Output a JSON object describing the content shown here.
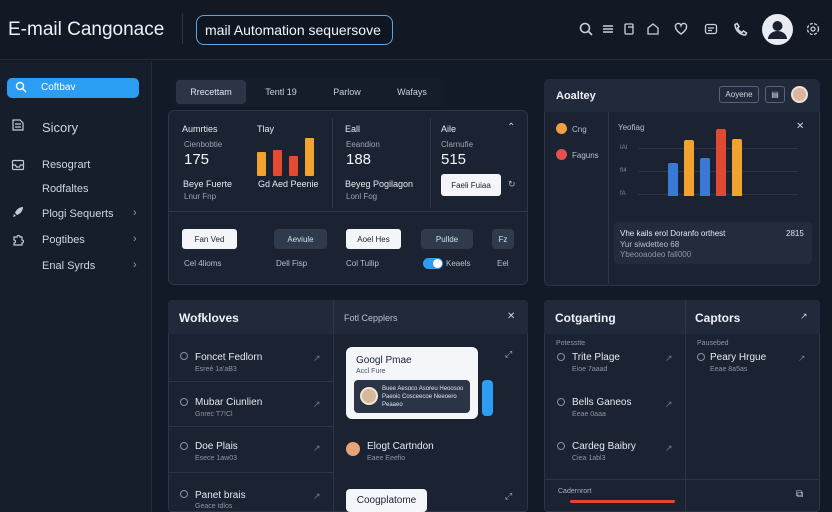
{
  "app": {
    "title": "E-mail Cangonace",
    "search_value": "mail Automation sequersove"
  },
  "header_icons": [
    "search-icon",
    "list-icon",
    "copy-icon",
    "tag-icon",
    "heart-icon",
    "message-icon",
    "phone-icon",
    "user-avatar",
    "settings-icon"
  ],
  "sidebar": {
    "items": [
      {
        "label": "Coftbav",
        "icon": "search-icon"
      },
      {
        "label": "Sicory",
        "icon": "book-icon"
      },
      {
        "label": "Resogrart",
        "icon": "inbox-icon"
      },
      {
        "label": "Rodfaltes",
        "icon": ""
      },
      {
        "label": "Plogi Sequerts",
        "icon": "rocket-icon"
      },
      {
        "label": "Pogtibes",
        "icon": "puzzle-icon"
      },
      {
        "label": "Enal Syrds",
        "icon": ""
      }
    ]
  },
  "tabs": [
    "Rrecettam",
    "Tentl 19",
    "Parlow",
    "Wafays"
  ],
  "cards": [
    {
      "title": "Aumrties",
      "sub": "Cienbobtie",
      "value": "175",
      "label": "Beye Fuerte",
      "note": "Lnur Fnp"
    },
    {
      "title": "Tlay",
      "sub": "",
      "value": "",
      "label": "Gd Aed Peenie",
      "note": ""
    },
    {
      "title": "Eall",
      "sub": "Eeandion",
      "value": "188",
      "label": "Beyeg Pogilagon",
      "note": "Lonl Fog"
    },
    {
      "title": "Aile",
      "sub": "Clarnufie",
      "value": "515",
      "label": "",
      "note": ""
    }
  ],
  "card_buttons": {
    "new": "Faeli Fuiaa",
    "refresh": "↻"
  },
  "actions": [
    {
      "label": "Fan Ved",
      "note": "Cel 4lioms",
      "style": "light"
    },
    {
      "label": "Aeviule",
      "note": "Dell Fisp",
      "style": "dark"
    },
    {
      "label": "Aoel Hes",
      "note": "Col Tullip",
      "style": "light"
    },
    {
      "label": "Pullde",
      "note": "Keaels",
      "style": "dark"
    },
    {
      "label": "Fz",
      "note": "Eel",
      "style": "dark"
    }
  ],
  "analytics": {
    "title": "Aoaltey",
    "dropdown": "Aoyene",
    "legend": [
      {
        "name": "Cng",
        "color": "#f0a040"
      },
      {
        "name": "Faguns",
        "color": "#e45050"
      }
    ],
    "chart_title": "Yeofiag",
    "y_ticks": [
      "IAI",
      "fI4",
      "fA",
      "0"
    ],
    "bars": [
      {
        "value": 0.34,
        "color": "#3a78d8"
      },
      {
        "value": 0.58,
        "color": "#f2a22e"
      },
      {
        "value": 0.4,
        "color": "#3a78d8"
      },
      {
        "value": 0.7,
        "color": "#e04a32"
      },
      {
        "value": 0.59,
        "color": "#f2a22e"
      }
    ],
    "summary_text": "Vhe kails erol Doranfo orthest",
    "summary_sub": "Yur siwdetteo 68",
    "summary_sub2": "Ybeooaodeo fall000",
    "summary_value": "2815"
  },
  "workflows": {
    "title": "Wofkloves",
    "subtitle": "Fotl Cepplers",
    "items": [
      {
        "title": "Foncet Fedlorn",
        "sub": "Esreé 1a'aB3"
      },
      {
        "title": "Mubar Ciunlien",
        "sub": "Gnrec T7!Cl"
      },
      {
        "title": "Doe Plais",
        "sub": "Esece 1aw03"
      },
      {
        "title": "Panet brais",
        "sub": "Geace tdlos"
      }
    ],
    "popup": {
      "title": "Googl Pmae",
      "sub": "Accl Fure",
      "body": "Buee Aesoco Asoreu Heoosoo Paeoic Cosceecoe Neeoero Peaaeo"
    },
    "contact": {
      "title": "Elogt Cartndon",
      "sub": "Eaee Eeefio"
    },
    "bottom_btn": "Coogplatome"
  },
  "categorizing": {
    "title": "Cotgarting",
    "label": "Potesstte",
    "items": [
      {
        "title": "Trite Plage",
        "sub": "Eioe 7aaad"
      },
      {
        "title": "Bells Ganeos",
        "sub": "Eeae 0aaa"
      },
      {
        "title": "Cardeg Baibry",
        "sub": "Ciea 1abl3"
      }
    ],
    "footer": "Cadernrort"
  },
  "captors": {
    "title": "Captors",
    "label": "Pausebed",
    "items": [
      {
        "title": "Peary Hrgue",
        "sub": "Eeae 8a5as"
      }
    ]
  }
}
